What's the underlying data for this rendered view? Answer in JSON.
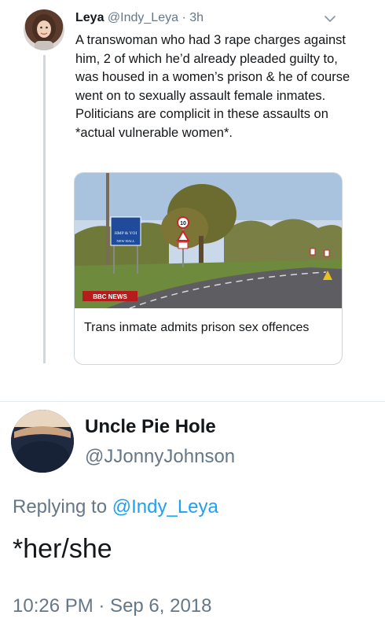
{
  "quoted_tweet": {
    "author_name": "Leya",
    "author_handle": "@Indy_Leya",
    "separator": "·",
    "time_ago": "3h",
    "text": "A transwoman who had 3 rape charges against him, 2 of which he’d already pleaded guilty to, was housed in a women’s prison & he of course went on to sexually assault female inmates. Politicians are complicit in these assaults on *actual vulnerable women*.",
    "avatar_icon": "profile-photo",
    "menu_icon": "chevron-down-icon",
    "card": {
      "image_icon": "road-sign-photo",
      "sign_text_1": "HMP & YOI",
      "sign_text_2": "NEW HALL",
      "speed_sign": "10",
      "watermark": "BBC NEWS",
      "title": "Trans inmate admits prison sex offences"
    }
  },
  "reply_tweet": {
    "author_name": "Uncle Pie Hole",
    "author_handle": "@JJonnyJohnson",
    "replying_label": "Replying to",
    "replying_to": "@Indy_Leya",
    "text": "*her/she",
    "timestamp": "10:26 PM · Sep 6, 2018",
    "avatar_icon": "profile-photo"
  },
  "colors": {
    "text_primary": "#14171a",
    "text_secondary": "#657786",
    "link": "#1da1f2",
    "border": "#ccd6dd"
  }
}
